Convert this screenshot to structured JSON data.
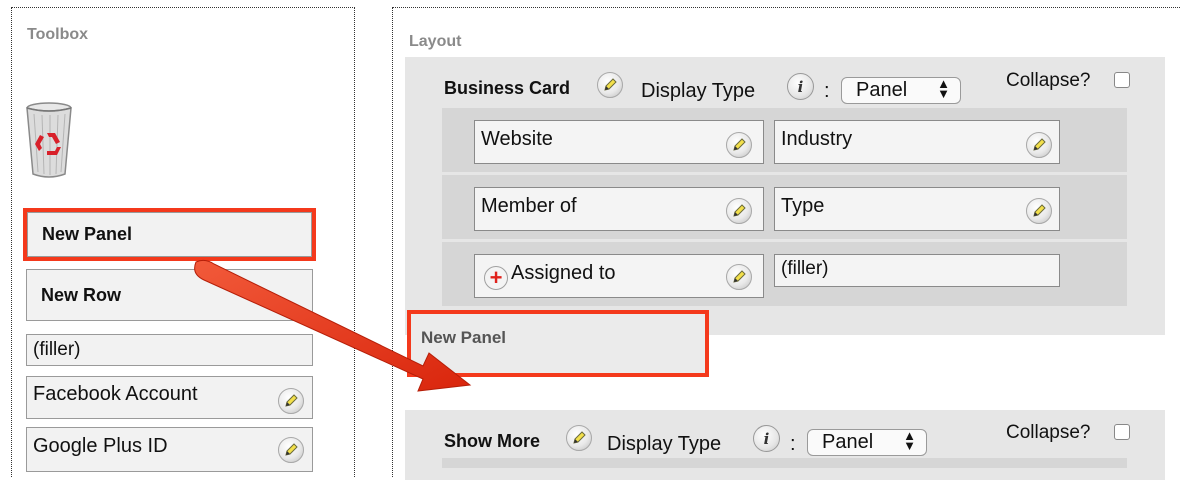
{
  "toolbox": {
    "title": "Toolbox",
    "items": {
      "new_panel": "New Panel",
      "new_row": "New Row",
      "filler": "(filler)",
      "facebook": "Facebook Account",
      "google": "Google Plus ID"
    }
  },
  "layout": {
    "title": "Layout",
    "panel1": {
      "name": "Business Card",
      "display_type_label": "Display Type",
      "colon": ":",
      "display_type_value": "Panel",
      "collapse_label": "Collapse?",
      "rows": [
        {
          "left": "Website",
          "right": "Industry"
        },
        {
          "left": "Member of",
          "right": "Type"
        },
        {
          "left": "Assigned to",
          "right": "(filler)"
        }
      ]
    },
    "new_panel": "New Panel",
    "panel2": {
      "name": "Show More",
      "display_type_label": "Display Type",
      "colon": ":",
      "display_type_value": "Panel",
      "collapse_label": "Collapse?"
    }
  },
  "colors": {
    "highlight": "#f4391c",
    "panel_bg": "#e6e6e6",
    "row_bg": "#d6d6d6"
  }
}
